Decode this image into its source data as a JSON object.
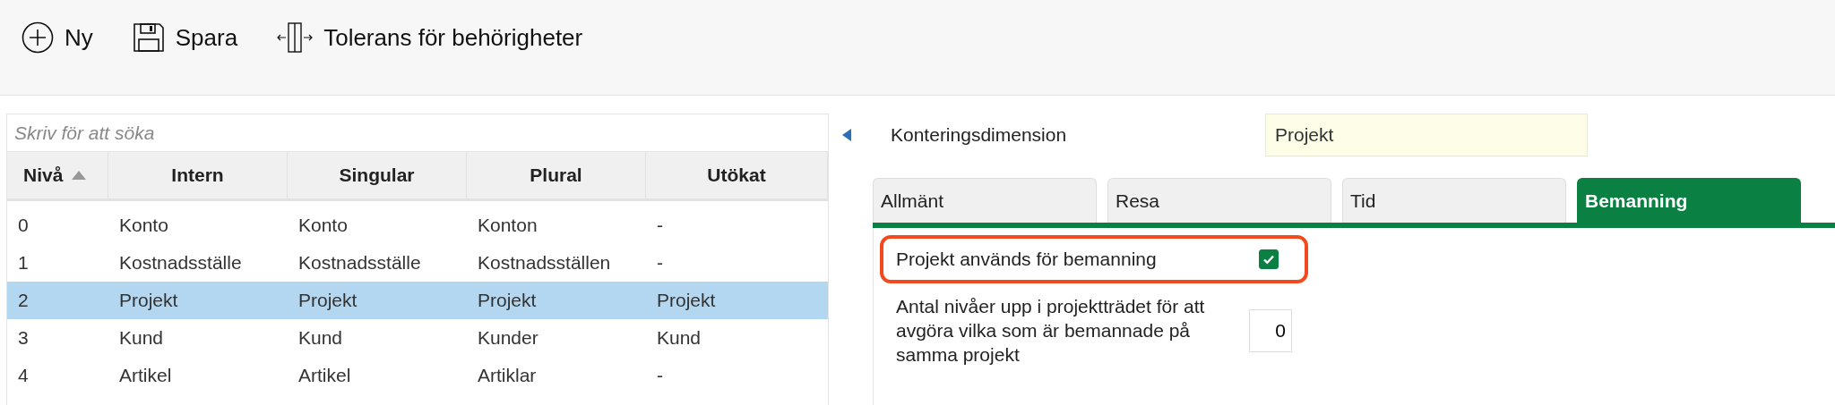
{
  "toolbar": [
    {
      "kind": "new",
      "label": "Ny"
    },
    {
      "kind": "save",
      "label": "Spara"
    },
    {
      "kind": "tolerance",
      "label": "Tolerans för behörigheter"
    }
  ],
  "search": {
    "placeholder": "Skriv för att söka"
  },
  "table": {
    "columns": [
      {
        "label": "Nivå",
        "sorted": true
      },
      {
        "label": "Intern",
        "sorted": false
      },
      {
        "label": "Singular",
        "sorted": false
      },
      {
        "label": "Plural",
        "sorted": false
      },
      {
        "label": "Utökat",
        "sorted": false
      }
    ],
    "rows": [
      {
        "cells": [
          "0",
          "Konto",
          "Konto",
          "Konton",
          "-"
        ],
        "selected": false
      },
      {
        "cells": [
          "1",
          "Kostnadsställe",
          "Kostnadsställe",
          "Kostnadsställen",
          "-"
        ],
        "selected": false
      },
      {
        "cells": [
          "2",
          "Projekt",
          "Projekt",
          "Projekt",
          "Projekt"
        ],
        "selected": true
      },
      {
        "cells": [
          "3",
          "Kund",
          "Kund",
          "Kunder",
          "Kund"
        ],
        "selected": false
      },
      {
        "cells": [
          "4",
          "Artikel",
          "Artikel",
          "Artiklar",
          "-"
        ],
        "selected": false
      }
    ]
  },
  "detail": {
    "label": "Konteringsdimension",
    "value": "Projekt"
  },
  "tabs": [
    {
      "label": "Allmänt",
      "selected": false
    },
    {
      "label": "Resa",
      "selected": false
    },
    {
      "label": "Tid",
      "selected": false
    },
    {
      "label": "Bemanning",
      "selected": true
    }
  ],
  "settings": [
    {
      "kind": "checkbox",
      "label": "Projekt används för bemanning",
      "checked": true,
      "highlighted": true
    },
    {
      "kind": "number",
      "label": "Antal nivåer upp i projektträdet för att avgöra vilka som är bemannade på samma projekt",
      "value": "0",
      "highlighted": false
    }
  ]
}
